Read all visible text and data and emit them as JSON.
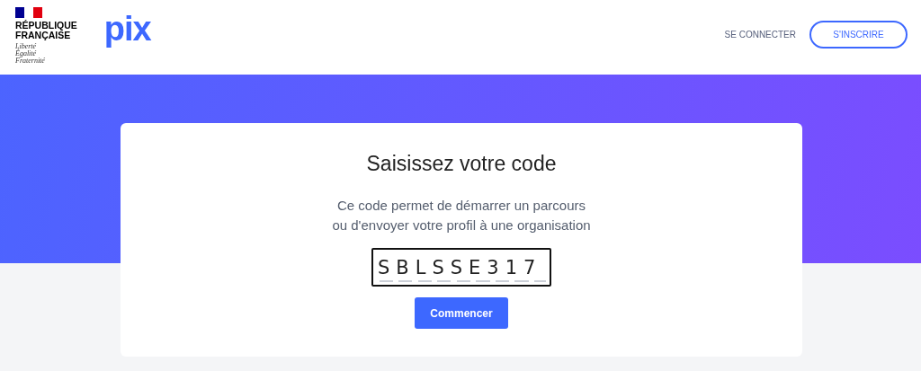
{
  "header": {
    "republic": {
      "name_lines": [
        "RÉPUBLIQUE",
        "FRANÇAISE"
      ],
      "motto_lines": [
        "Liberté",
        "Égalité",
        "Fraternité"
      ]
    },
    "logo": "pix",
    "links": [
      {
        "label": "SE CONNECTER",
        "kind": "link"
      },
      {
        "label": "S'INSCRIRE",
        "kind": "outline"
      }
    ]
  },
  "card": {
    "title": "Saisissez votre code",
    "description_lines": [
      "Ce code permet de démarrer un parcours",
      "ou d'envoyer votre profil à une organisation"
    ],
    "code_field": {
      "value": "SBLSSE317"
    },
    "button": "Commencer"
  }
}
